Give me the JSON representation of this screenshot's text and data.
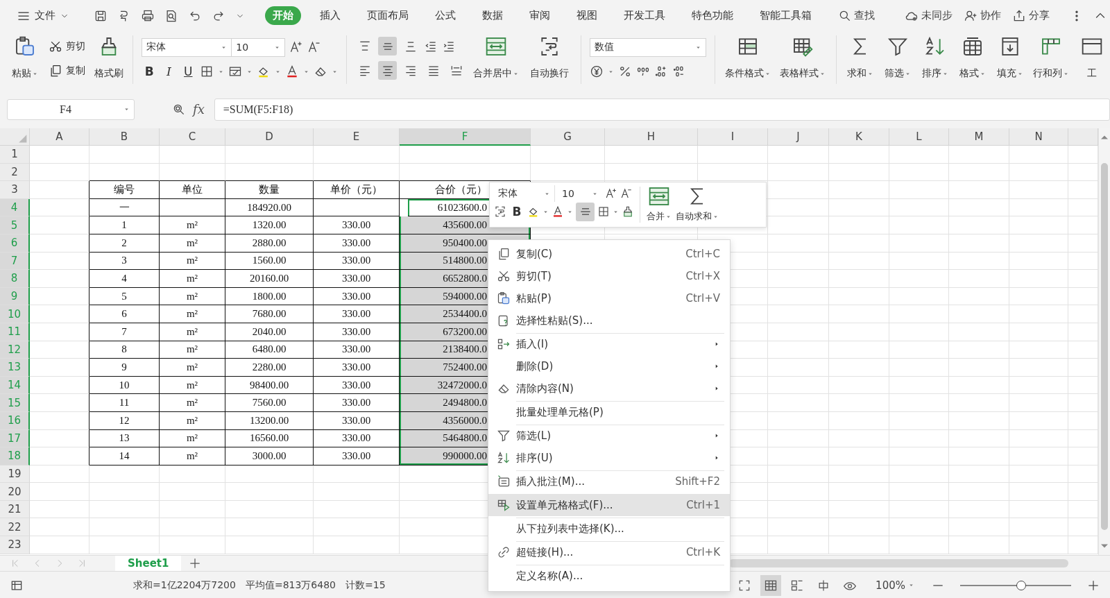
{
  "menubar": {
    "file": "文件",
    "tabs": [
      {
        "label": "开始",
        "selected": true
      },
      {
        "label": "插入",
        "selected": false
      },
      {
        "label": "页面布局",
        "selected": false
      },
      {
        "label": "公式",
        "selected": false
      },
      {
        "label": "数据",
        "selected": false
      },
      {
        "label": "审阅",
        "selected": false
      },
      {
        "label": "视图",
        "selected": false
      },
      {
        "label": "开发工具",
        "selected": false
      },
      {
        "label": "特色功能",
        "selected": false
      },
      {
        "label": "智能工具箱",
        "selected": false
      }
    ],
    "search": "查找",
    "actions": [
      "未同步",
      "协作",
      "分享"
    ]
  },
  "ribbon": {
    "paste": "粘贴",
    "cut": "剪切",
    "copy": "复制",
    "format_painter": "格式刷",
    "font": "宋体",
    "font_size": "10",
    "bold": "B",
    "italic": "I",
    "underline": "U",
    "valign": [
      {
        "selected": false
      },
      {
        "selected": true
      },
      {
        "selected": false
      }
    ],
    "halign": [
      {
        "selected": false
      },
      {
        "selected": true
      },
      {
        "selected": false
      },
      {
        "selected": false
      },
      {
        "selected": false
      }
    ],
    "merge": "合并居中",
    "wrap": "自动换行",
    "number_format": "数值",
    "styles": [
      "条件格式",
      "表格样式"
    ],
    "tools": [
      "求和",
      "筛选",
      "排序",
      "格式",
      "填充",
      "行和列",
      "工"
    ]
  },
  "formula_bar": {
    "cell": "F4",
    "fx": "fx",
    "formula": "=SUM(F5:F18)"
  },
  "sheet": {
    "columns": [
      {
        "label": "A",
        "selected": false
      },
      {
        "label": "B",
        "selected": false
      },
      {
        "label": "C",
        "selected": false
      },
      {
        "label": "D",
        "selected": false
      },
      {
        "label": "E",
        "selected": false
      },
      {
        "label": "F",
        "selected": true
      },
      {
        "label": "G",
        "selected": false
      },
      {
        "label": "H",
        "selected": false
      },
      {
        "label": "I",
        "selected": false
      },
      {
        "label": "J",
        "selected": false
      },
      {
        "label": "K",
        "selected": false
      },
      {
        "label": "L",
        "selected": false
      },
      {
        "label": "M",
        "selected": false
      },
      {
        "label": "N",
        "selected": false
      }
    ],
    "rows": [
      {
        "label": "1",
        "selected": false
      },
      {
        "label": "2",
        "selected": false
      },
      {
        "label": "3",
        "selected": false
      },
      {
        "label": "4",
        "selected": true
      },
      {
        "label": "5",
        "selected": true
      },
      {
        "label": "6",
        "selected": true
      },
      {
        "label": "7",
        "selected": true
      },
      {
        "label": "8",
        "selected": true
      },
      {
        "label": "9",
        "selected": true
      },
      {
        "label": "10",
        "selected": true
      },
      {
        "label": "11",
        "selected": true
      },
      {
        "label": "12",
        "selected": true
      },
      {
        "label": "13",
        "selected": true
      },
      {
        "label": "14",
        "selected": true
      },
      {
        "label": "15",
        "selected": true
      },
      {
        "label": "16",
        "selected": true
      },
      {
        "label": "17",
        "selected": true
      },
      {
        "label": "18",
        "selected": true
      },
      {
        "label": "19",
        "selected": false
      },
      {
        "label": "20",
        "selected": false
      },
      {
        "label": "21",
        "selected": false
      },
      {
        "label": "22",
        "selected": false
      },
      {
        "label": "23",
        "selected": false
      }
    ]
  },
  "table": {
    "header": [
      "编号",
      "单位",
      "数量",
      "单价（元）",
      "合价（元）"
    ],
    "rows": [
      {
        "no": "一",
        "quantity": "184920.00",
        "total": "61023600.0"
      },
      {
        "no": "1",
        "unit": "m²",
        "quantity": "1320.00",
        "price": "330.00",
        "total": "435600.00"
      },
      {
        "no": "2",
        "unit": "m²",
        "quantity": "2880.00",
        "price": "330.00",
        "total": "950400.00"
      },
      {
        "no": "3",
        "unit": "m²",
        "quantity": "1560.00",
        "price": "330.00",
        "total": "514800.00"
      },
      {
        "no": "4",
        "unit": "m²",
        "quantity": "20160.00",
        "price": "330.00",
        "total": "6652800.0"
      },
      {
        "no": "5",
        "unit": "m²",
        "quantity": "1800.00",
        "price": "330.00",
        "total": "594000.00"
      },
      {
        "no": "6",
        "unit": "m²",
        "quantity": "7680.00",
        "price": "330.00",
        "total": "2534400.0"
      },
      {
        "no": "7",
        "unit": "m²",
        "quantity": "2040.00",
        "price": "330.00",
        "total": "673200.00"
      },
      {
        "no": "8",
        "unit": "m²",
        "quantity": "6480.00",
        "price": "330.00",
        "total": "2138400.0"
      },
      {
        "no": "9",
        "unit": "m²",
        "quantity": "2280.00",
        "price": "330.00",
        "total": "752400.00"
      },
      {
        "no": "10",
        "unit": "m²",
        "quantity": "98400.00",
        "price": "330.00",
        "total": "32472000.0"
      },
      {
        "no": "11",
        "unit": "m²",
        "quantity": "7560.00",
        "price": "330.00",
        "total": "2494800.0"
      },
      {
        "no": "12",
        "unit": "m²",
        "quantity": "13200.00",
        "price": "330.00",
        "total": "4356000.0"
      },
      {
        "no": "13",
        "unit": "m²",
        "quantity": "16560.00",
        "price": "330.00",
        "total": "5464800.0"
      },
      {
        "no": "14",
        "unit": "m²",
        "quantity": "3000.00",
        "price": "330.00",
        "total": "990000.00"
      }
    ]
  },
  "mini_toolbar": {
    "font": "宋体",
    "font_size": "10",
    "bold": "B",
    "align": {
      "selected": true
    },
    "merge": "合并",
    "autosum": "自动求和"
  },
  "context_menu": [
    {
      "label": "复制(C)",
      "shortcut": "Ctrl+C",
      "submenu": false,
      "divider": false,
      "selected": false
    },
    {
      "label": "剪切(T)",
      "shortcut": "Ctrl+X",
      "submenu": false,
      "divider": false,
      "selected": false
    },
    {
      "label": "粘贴(P)",
      "shortcut": "Ctrl+V",
      "submenu": false,
      "divider": false,
      "selected": false
    },
    {
      "label": "选择性粘贴(S)...",
      "submenu": false,
      "divider": false,
      "selected": false
    },
    {
      "label": "插入(I)",
      "submenu": true,
      "divider": true,
      "selected": false
    },
    {
      "label": "删除(D)",
      "submenu": true,
      "divider": false,
      "selected": false
    },
    {
      "label": "清除内容(N)",
      "submenu": true,
      "divider": false,
      "selected": false
    },
    {
      "label": "批量处理单元格(P)",
      "submenu": false,
      "divider": true,
      "selected": false
    },
    {
      "label": "筛选(L)",
      "submenu": true,
      "divider": true,
      "selected": false
    },
    {
      "label": "排序(U)",
      "submenu": true,
      "divider": false,
      "selected": false
    },
    {
      "label": "插入批注(M)...",
      "shortcut": "Shift+F2",
      "submenu": false,
      "divider": true,
      "selected": false
    },
    {
      "label": "设置单元格格式(F)...",
      "shortcut": "Ctrl+1",
      "submenu": false,
      "divider": true,
      "selected": true
    },
    {
      "label": "从下拉列表中选择(K)...",
      "submenu": false,
      "divider": true,
      "selected": false
    },
    {
      "label": "超链接(H)...",
      "shortcut": "Ctrl+K",
      "submenu": false,
      "divider": true,
      "selected": false
    },
    {
      "label": "定义名称(A)...",
      "submenu": false,
      "divider": true,
      "selected": false
    }
  ],
  "sheet_tabs": [
    {
      "label": "Sheet1",
      "selected": true
    }
  ],
  "status_bar": {
    "sum": "求和=1亿2204万7200",
    "average": "平均值=813万6480",
    "count": "计数=15",
    "views": [
      {
        "selected": false
      },
      {
        "selected": true
      },
      {
        "selected": false
      },
      {
        "selected": false
      },
      {
        "selected": false
      }
    ],
    "zoom": "100%",
    "zoom_slider": {
      "level": 0.55
    }
  }
}
